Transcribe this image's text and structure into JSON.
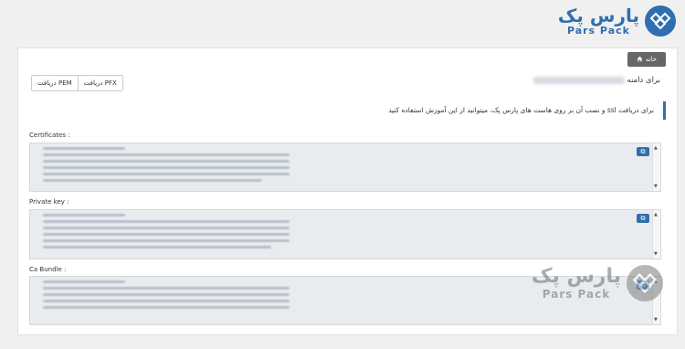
{
  "brand": {
    "name_fa": "پارس پک",
    "name_en": "Pars Pack"
  },
  "header": {
    "home_label": "خانه",
    "domain_label": "برای دامنه"
  },
  "downloads": {
    "pfx_label": "دریافت PFX",
    "pem_label": "دریافت PEM"
  },
  "notice": {
    "text": "برای دریافت ssl و نصب آن بر روی هاست های پارس پک، میتوانید از این آموزش استفاده کنید"
  },
  "fields": {
    "certificates_label": "Certificates :",
    "private_key_label": "Private key :",
    "ca_bundle_label": "Ca Bundle :"
  },
  "watermark": {
    "name_fa": "پارس پک",
    "name_en": "Pars Pack"
  },
  "colors": {
    "brand_blue": "#2f6fb0",
    "home_button": "#666666",
    "textarea_bg": "#e9ecef"
  },
  "icons": {
    "home": "home-icon",
    "copy": "copy-icon"
  }
}
